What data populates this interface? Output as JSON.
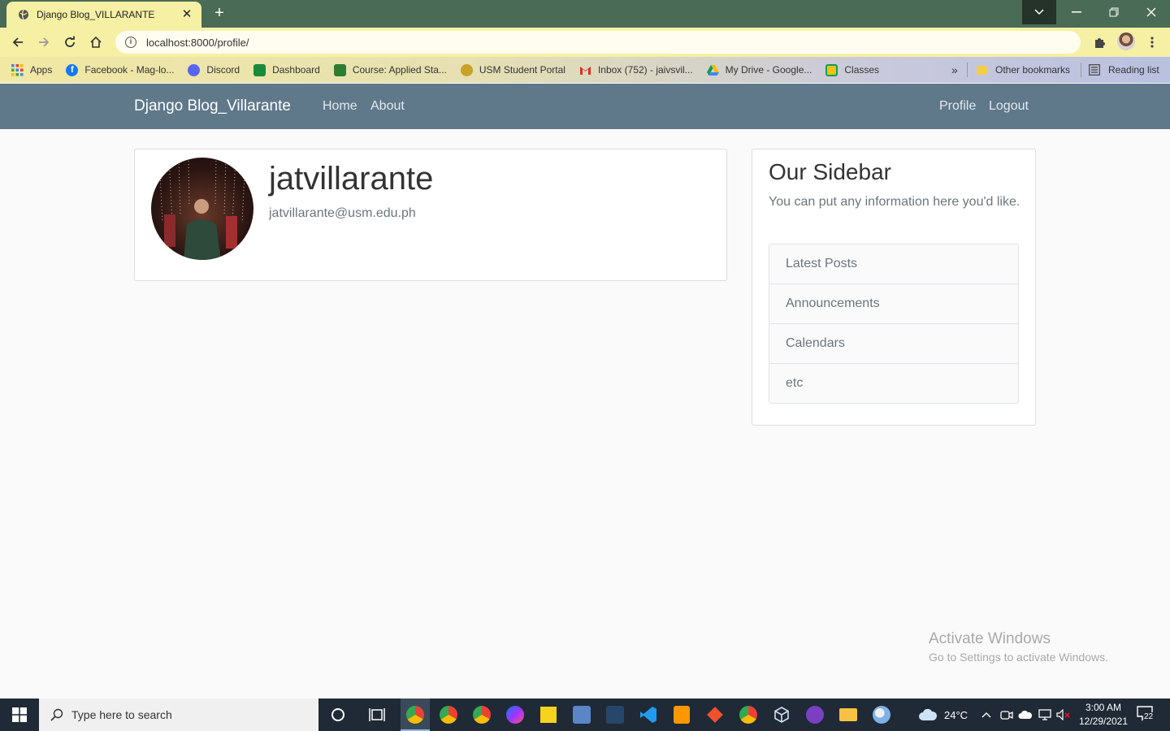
{
  "browser": {
    "tab_title": "Django Blog_VILLARANTE",
    "tab_close": "✕",
    "new_tab": "+",
    "url": "localhost:8000/profile/",
    "bookmarks": [
      {
        "label": "Apps",
        "icon": "apps-grid-icon",
        "color": "#4285f4"
      },
      {
        "label": "Facebook - Mag-lo...",
        "icon": "facebook-icon",
        "color": "#1877f2"
      },
      {
        "label": "Discord",
        "icon": "discord-icon",
        "color": "#5865f2"
      },
      {
        "label": "Dashboard",
        "icon": "dashboard-icon",
        "color": "#1a8a3a"
      },
      {
        "label": "Course: Applied Sta...",
        "icon": "course-icon",
        "color": "#2e7d32"
      },
      {
        "label": "USM Student Portal",
        "icon": "usm-icon",
        "color": "#c9a227"
      },
      {
        "label": "Inbox (752) - jaivsvil...",
        "icon": "gmail-icon",
        "color": "#d93025"
      },
      {
        "label": "My Drive - Google...",
        "icon": "drive-icon",
        "color": "#fbbc04"
      },
      {
        "label": "Classes",
        "icon": "classroom-icon",
        "color": "#0f9d58"
      }
    ],
    "overflow": "»",
    "other_bookmarks": "Other bookmarks",
    "reading_list": "Reading list"
  },
  "site": {
    "brand": "Django Blog_Villarante",
    "nav_left": [
      "Home",
      "About"
    ],
    "nav_right": [
      "Profile",
      "Logout"
    ],
    "nav_color": "#5f788a"
  },
  "profile": {
    "username": "jatvillarante",
    "email": "jatvillarante@usm.edu.ph"
  },
  "sidebar": {
    "title": "Our Sidebar",
    "text": "You can put any information here you'd like.",
    "items": [
      "Latest Posts",
      "Announcements",
      "Calendars",
      "etc"
    ]
  },
  "watermark": {
    "line1": "Activate Windows",
    "line2": "Go to Settings to activate Windows."
  },
  "taskbar": {
    "search_placeholder": "Type here to search",
    "temperature": "24°C",
    "time": "3:00 AM",
    "date": "12/29/2021",
    "notifications": "22"
  }
}
